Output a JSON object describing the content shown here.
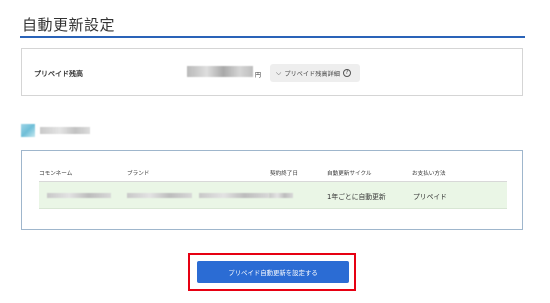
{
  "page": {
    "title": "自動更新設定"
  },
  "balance": {
    "label": "プリペイド残高",
    "currency": "円",
    "detail_button": "プリペイド残高詳細"
  },
  "table": {
    "headers": [
      "コモンネーム",
      "ブランド",
      "契約終了日",
      "自動更新サイクル",
      "お支払い方法"
    ],
    "rows": [
      {
        "cycle": "1年ごとに自動更新",
        "payment": "プリペイド"
      }
    ]
  },
  "cta": {
    "label": "プリペイド自動更新を設定する"
  },
  "colors": {
    "accent": "#2a63b8",
    "button": "#2b6cd4",
    "highlight_frame": "#e60012",
    "row_background": "#eaf6e6"
  },
  "icons": {
    "chevron": "chevron-down-icon",
    "help": "help-circle-icon"
  }
}
